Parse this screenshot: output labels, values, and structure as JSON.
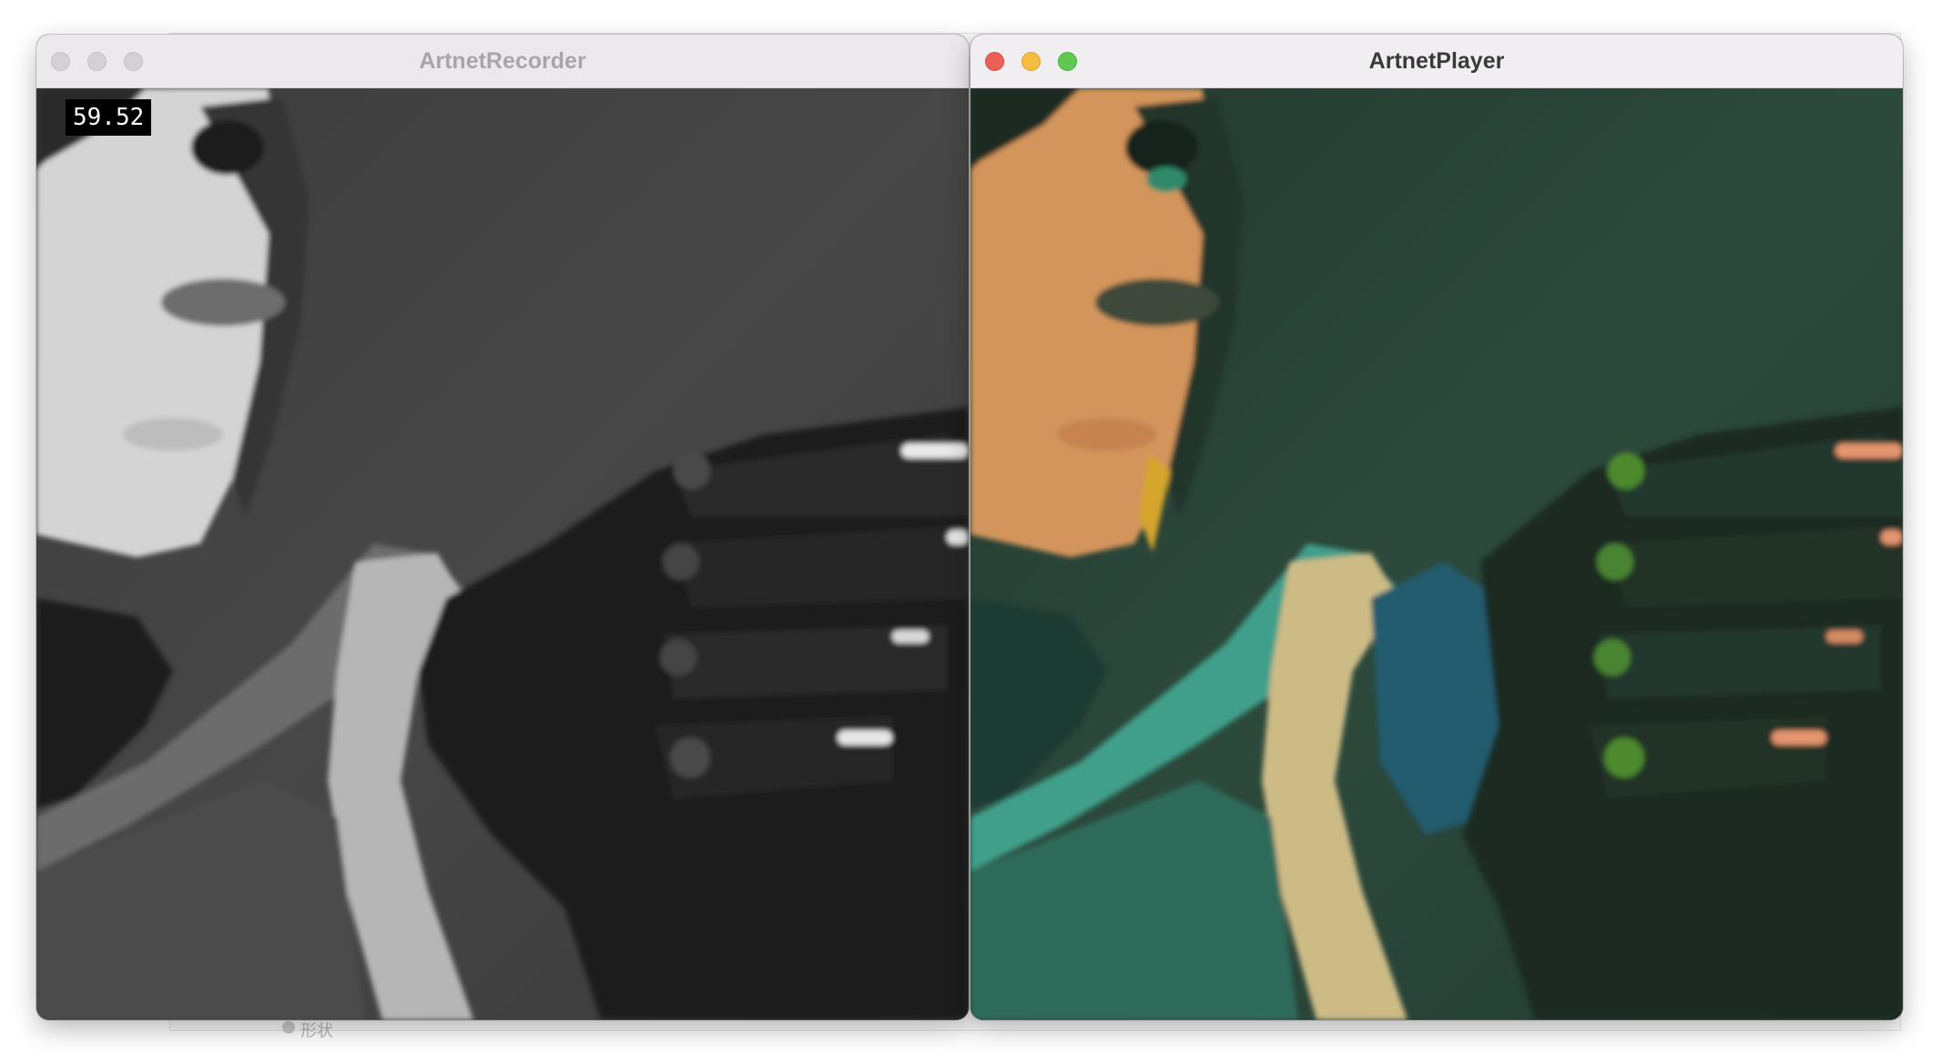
{
  "windows": {
    "recorder": {
      "title": "ArtnetRecorder",
      "fps_readout": "59.52",
      "color_mode": "grayscale"
    },
    "player": {
      "title": "ArtnetPlayer",
      "color_mode": "color"
    }
  },
  "desktop": {
    "background_label": "形状"
  },
  "colors": {
    "close": "#ed5f55",
    "minimize": "#f5bd3f",
    "maximize": "#5fc850",
    "inactive_light": "#d3d1d5"
  }
}
